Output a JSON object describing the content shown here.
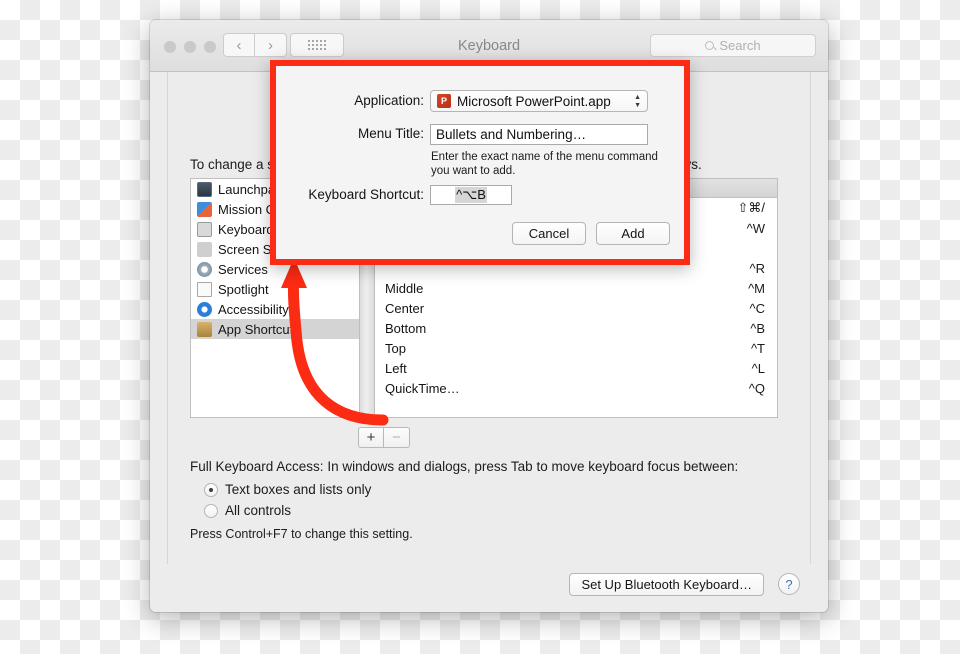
{
  "window": {
    "title": "Keyboard",
    "search_placeholder": "Search",
    "nav_back": "‹",
    "nav_forward": "›",
    "grid_icon": "grid-icon"
  },
  "content": {
    "instruction": "To change a shortcut, select it, click the key combination, and then type the new keys.",
    "full_keyboard_access": "Full Keyboard Access: In windows and dialogs, press Tab to move keyboard focus between:",
    "radio_options": [
      {
        "label": "Text boxes and lists only",
        "selected": true
      },
      {
        "label": "All controls",
        "selected": false
      }
    ],
    "note": "Press Control+F7 to change this setting.",
    "add_button": "+",
    "remove_button": "−"
  },
  "sidebar": {
    "items": [
      {
        "label": "Launchpad & Dock",
        "icon": "launchpad-icon",
        "selected": false
      },
      {
        "label": "Mission Control",
        "icon": "mission-control-icon",
        "selected": false
      },
      {
        "label": "Keyboard",
        "icon": "keyboard-icon",
        "selected": false
      },
      {
        "label": "Screen Shots",
        "icon": "screenshot-icon",
        "selected": false
      },
      {
        "label": "Services",
        "icon": "services-gear-icon",
        "selected": false
      },
      {
        "label": "Spotlight",
        "icon": "spotlight-icon",
        "selected": false
      },
      {
        "label": "Accessibility",
        "icon": "accessibility-icon",
        "selected": false
      },
      {
        "label": "App Shortcuts",
        "icon": "app-shortcuts-icon",
        "selected": true
      }
    ]
  },
  "shortcut_list": {
    "rows": [
      {
        "label": "",
        "key": "⇧⌘/"
      },
      {
        "label": "",
        "key": "^W"
      },
      {
        "label": "",
        "key": ""
      },
      {
        "label": "",
        "key": "^R"
      },
      {
        "label": "Middle",
        "key": "^M"
      },
      {
        "label": "Center",
        "key": "^C"
      },
      {
        "label": "Bottom",
        "key": "^B"
      },
      {
        "label": "Top",
        "key": "^T"
      },
      {
        "label": "Left",
        "key": "^L"
      },
      {
        "label": "QuickTime…",
        "key": "^Q"
      }
    ]
  },
  "dialog": {
    "application_label": "Application:",
    "application_value": "Microsoft PowerPoint.app",
    "application_icon": "powerpoint-icon",
    "menu_title_label": "Menu Title:",
    "menu_title_value": "Bullets and Numbering…",
    "hint": "Enter the exact name of the menu command you want to add.",
    "keyboard_shortcut_label": "Keyboard Shortcut:",
    "keyboard_shortcut_value": "^⌥B",
    "cancel_label": "Cancel",
    "add_label": "Add"
  },
  "bottom": {
    "bluetooth_label": "Set Up Bluetooth Keyboard…",
    "help_label": "?"
  },
  "colors": {
    "highlight_red": "#fc2b14",
    "window_bg": "#ececec"
  }
}
